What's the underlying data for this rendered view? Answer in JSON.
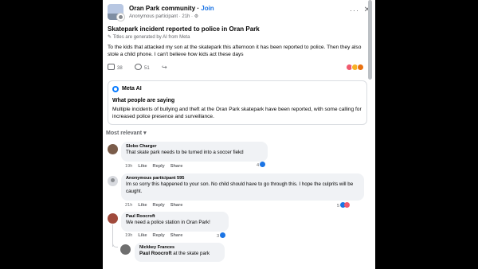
{
  "header": {
    "group_name": "Oran Park community",
    "separator": " · ",
    "join_label": "Join",
    "subline": "Anonymous participant · 21h · ",
    "more_label": "···",
    "close_label": "✕"
  },
  "post": {
    "title": "Skatepark incident reported to police in Oran Park",
    "ai_note": "Titles are generated by AI from Meta",
    "body": "To the kids that attacked my son at the skatepark this afternoon it has been reported to police. Then they also stole a child phone. I can't believe how kids act these days",
    "like_count": "38",
    "comment_count": "51",
    "reaction_icons": [
      "angry-icon",
      "haha-icon",
      "wow-icon"
    ]
  },
  "meta_ai": {
    "label": "Meta AI",
    "heading": "What people are saying",
    "body": "Multiple incidents of bullying and theft at the Oran Park skatepark have been reported, with some calling for increased police presence and surveillance."
  },
  "sort": {
    "label": "Most relevant ▾"
  },
  "comments": [
    {
      "name": "Slobo Charger",
      "text": "That skate park needs to be turned into a soccer fiekd",
      "time": "19h",
      "like": "Like",
      "reply": "Reply",
      "share": "Share",
      "reaction_count": "4"
    },
    {
      "name": "Anonymous participant 595",
      "text": "Im so sorry this happened to your son. No child should have to go through this. I hope the culprits will be caught.",
      "time": "21h",
      "like": "Like",
      "reply": "Reply",
      "share": "Share",
      "reaction_count": "5"
    },
    {
      "name": "Paul Roocroft",
      "text": "We need a police station in Oran Park!",
      "time": "19h",
      "like": "Like",
      "reply": "Reply",
      "share": "Share",
      "reaction_count": "3"
    }
  ],
  "reply": {
    "name": "Nickkey Frances",
    "mention": "Paul Roocroft",
    "text": " at the skate park"
  },
  "colors": {
    "accent": "#1b74e4",
    "secondary_text": "#65676b",
    "bubble": "#f0f2f5"
  }
}
